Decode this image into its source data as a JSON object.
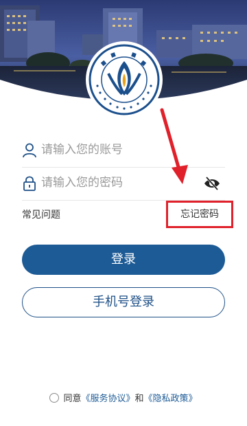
{
  "login": {
    "account_placeholder": "请输入您的账号",
    "password_placeholder": "请输入您的密码",
    "faq_label": "常见问题",
    "forgot_label": "忘记密码",
    "login_button": "登录",
    "phone_login_button": "手机号登录"
  },
  "agreement": {
    "prefix": "同意",
    "service_link": "《服务协议》",
    "and": "和",
    "privacy_link": "《隐私政策》"
  },
  "icons": {
    "account": "user-icon",
    "password": "lock-icon",
    "visibility": "eye-hidden-icon"
  },
  "colors": {
    "primary": "#1d5b96",
    "highlight": "#e0202a",
    "placeholder": "#9a9a9a"
  }
}
